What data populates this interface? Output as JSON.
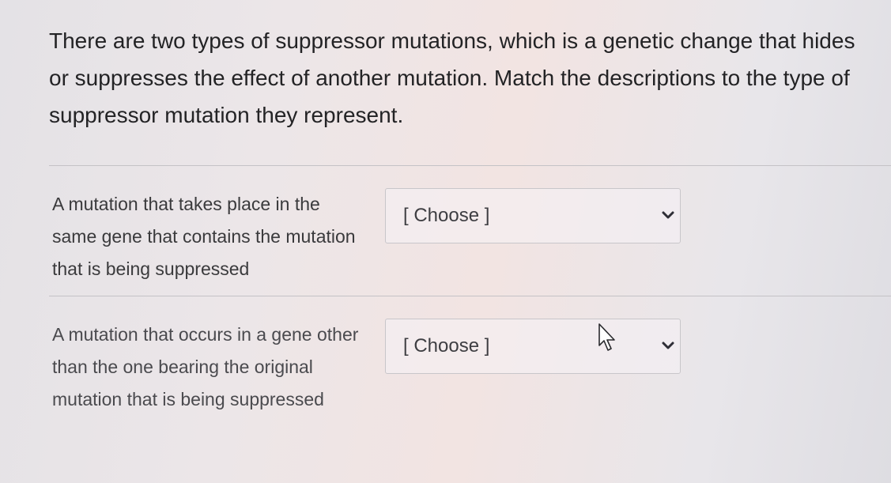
{
  "question": {
    "text": "There are two types of suppressor mutations, which is a genetic change that hides or suppresses the effect of another mutation. Match the descriptions to the type of suppressor mutation they represent."
  },
  "rows": [
    {
      "description": "A mutation that takes place in the same gene that contains the mutation that is being suppressed",
      "select": {
        "selected": "[ Choose ]"
      }
    },
    {
      "description": "A mutation that occurs in a gene other than the one bearing the original mutation that is being suppressed",
      "select": {
        "selected": "[ Choose ]"
      }
    }
  ],
  "icons": {
    "dropdown": "chevron-down-icon",
    "pointer": "mouse-cursor-icon"
  },
  "colors": {
    "text": "#232325",
    "border": "#c8c6ca"
  }
}
